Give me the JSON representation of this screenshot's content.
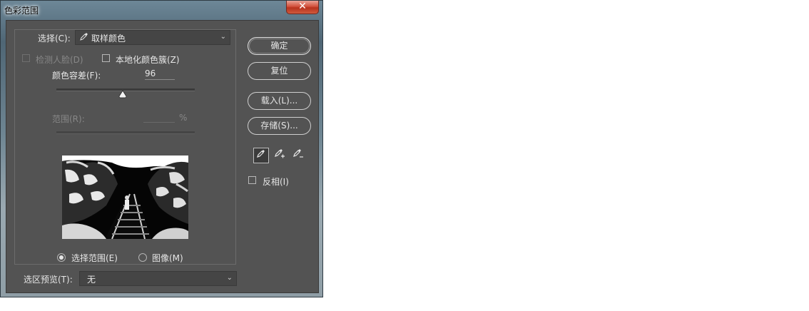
{
  "window": {
    "title": "色彩范围",
    "close_glyph": "✕"
  },
  "select": {
    "label": "选择(C):",
    "value": "取样颜色",
    "icon": "eyedropper-icon"
  },
  "options": {
    "detect_faces": "检测人脸(D)",
    "localized_clusters": "本地化颜色簇(Z)"
  },
  "fuzziness": {
    "label": "颜色容差(F):",
    "value": "96",
    "level_percent": 46
  },
  "range": {
    "label": "范围(R):",
    "value": "",
    "unit": "%"
  },
  "preview_mode": {
    "selection_label": "选择范围(E)",
    "image_label": "图像(M)",
    "selected": "selection"
  },
  "selection_preview": {
    "label": "选区预览(T):",
    "value": "无"
  },
  "buttons": {
    "ok": "确定",
    "reset": "复位",
    "load": "载入(L)...",
    "save": "存储(S)..."
  },
  "eyedroppers": [
    "eyedropper-icon",
    "eyedropper-add-icon",
    "eyedropper-subtract-icon"
  ],
  "invert": {
    "label": "反相(I)",
    "checked": false
  },
  "colors": {
    "panel_bg": "#535353",
    "text": "#e6e6e6",
    "disabled_text": "#878787"
  }
}
